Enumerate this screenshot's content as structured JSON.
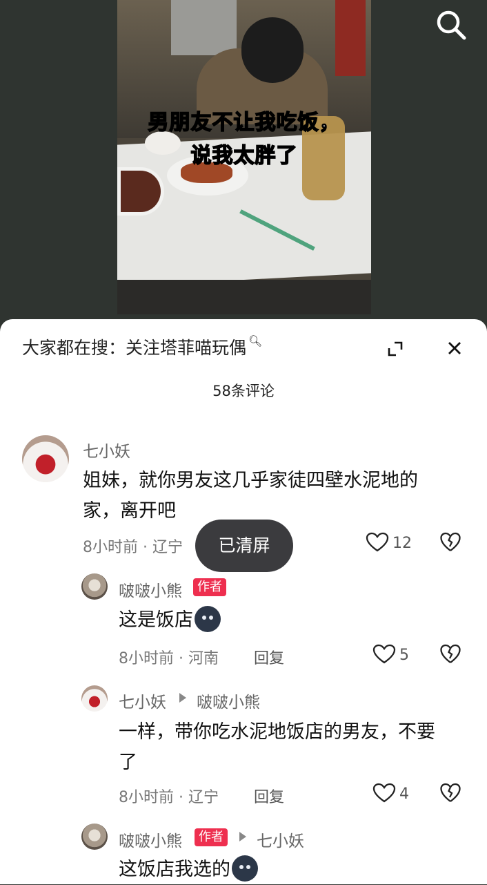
{
  "video": {
    "caption_line1": "男朋友不让我吃饭，",
    "caption_line2": "说我太胖了"
  },
  "sheet": {
    "trending_prefix": "大家都在搜：",
    "trending_query": "关注塔菲喵玩偶",
    "comment_count": "58条评论"
  },
  "toast": "已清屏",
  "comments": [
    {
      "user": "七小妖",
      "text_line1": "姐妹，就你男友这几乎家徒四壁水泥地的",
      "text_line2": "家，离开吧",
      "time": "8小时前",
      "location": "辽宁",
      "likes": "12"
    },
    {
      "user": "啵啵小熊",
      "badge": "作者",
      "text": "这是饭店",
      "time": "8小时前",
      "location": "河南",
      "reply": "回复",
      "likes": "5"
    },
    {
      "user": "七小妖",
      "reply_to": "啵啵小熊",
      "text_line1": "一样，带你吃水泥地饭店的男友，不要",
      "text_line2": "了",
      "time": "8小时前",
      "location": "辽宁",
      "reply": "回复",
      "likes": "4"
    },
    {
      "user": "啵啵小熊",
      "badge": "作者",
      "reply_to": "七小妖",
      "text": "这饭店我选的"
    }
  ],
  "colors": {
    "badge": "#ee2f4f",
    "toast": "#3b3b3e"
  }
}
